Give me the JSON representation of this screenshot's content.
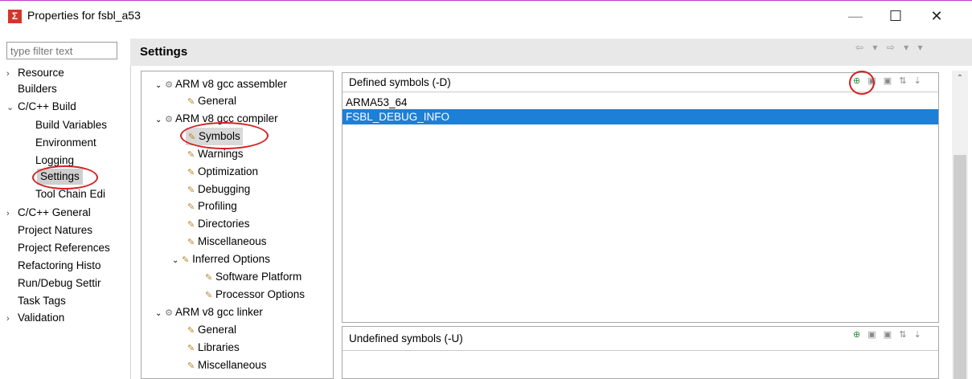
{
  "window": {
    "title": "Properties for fsbl_a53",
    "minimize": "—",
    "maximize": "☐",
    "close": "✕"
  },
  "filter": {
    "placeholder": "type filter text"
  },
  "nav": [
    {
      "label": "Resource",
      "chev": "›"
    },
    {
      "label": "Builders",
      "chev": ""
    },
    {
      "label": "C/C++ Build",
      "chev": "⌄"
    },
    {
      "label": "Build Variables",
      "chev": ""
    },
    {
      "label": "Environment",
      "chev": ""
    },
    {
      "label": "Logging",
      "chev": ""
    },
    {
      "label": "Settings",
      "chev": ""
    },
    {
      "label": "Tool Chain Edi",
      "chev": ""
    },
    {
      "label": "C/C++ General",
      "chev": "›"
    },
    {
      "label": "Project Natures",
      "chev": ""
    },
    {
      "label": "Project References",
      "chev": ""
    },
    {
      "label": "Refactoring Histo",
      "chev": ""
    },
    {
      "label": "Run/Debug Settir",
      "chev": ""
    },
    {
      "label": "Task Tags",
      "chev": ""
    },
    {
      "label": "Validation",
      "chev": "›"
    }
  ],
  "settings": {
    "title": "Settings",
    "nav_arrows": "⇦ ▾ ⇨ ▾ ▾"
  },
  "tree": [
    {
      "label": "ARM v8 gcc assembler",
      "expand": "⌄",
      "icon": "⚙"
    },
    {
      "label": "General",
      "expand": "",
      "icon": "✎"
    },
    {
      "label": "ARM v8 gcc compiler",
      "expand": "⌄",
      "icon": "⚙"
    },
    {
      "label": "Symbols",
      "expand": "",
      "icon": "✎"
    },
    {
      "label": "Warnings",
      "expand": "",
      "icon": "✎"
    },
    {
      "label": "Optimization",
      "expand": "",
      "icon": "✎"
    },
    {
      "label": "Debugging",
      "expand": "",
      "icon": "✎"
    },
    {
      "label": "Profiling",
      "expand": "",
      "icon": "✎"
    },
    {
      "label": "Directories",
      "expand": "",
      "icon": "✎"
    },
    {
      "label": "Miscellaneous",
      "expand": "",
      "icon": "✎"
    },
    {
      "label": "Inferred Options",
      "expand": "⌄",
      "icon": "✎"
    },
    {
      "label": "Software Platform",
      "expand": "",
      "icon": "✎"
    },
    {
      "label": "Processor Options",
      "expand": "",
      "icon": "✎"
    },
    {
      "label": "ARM v8 gcc linker",
      "expand": "⌄",
      "icon": "⚙"
    },
    {
      "label": "General",
      "expand": "",
      "icon": "✎"
    },
    {
      "label": "Libraries",
      "expand": "",
      "icon": "✎"
    },
    {
      "label": "Miscellaneous",
      "expand": "",
      "icon": "✎"
    }
  ],
  "defined": {
    "title": "Defined symbols (-D)",
    "tools": "⊕ ▣ ▣ ⇅ ⇣",
    "items": [
      "ARMA53_64",
      "FSBL_DEBUG_INFO"
    ],
    "selected_index": 1
  },
  "undefined": {
    "title": "Undefined symbols (-U)",
    "tools": "⊕ ▣ ▣ ⇅ ⇣"
  },
  "scroll_up": "⌃",
  "colors": {
    "selection": "#1e7fd6",
    "annotation": "#d42020"
  }
}
